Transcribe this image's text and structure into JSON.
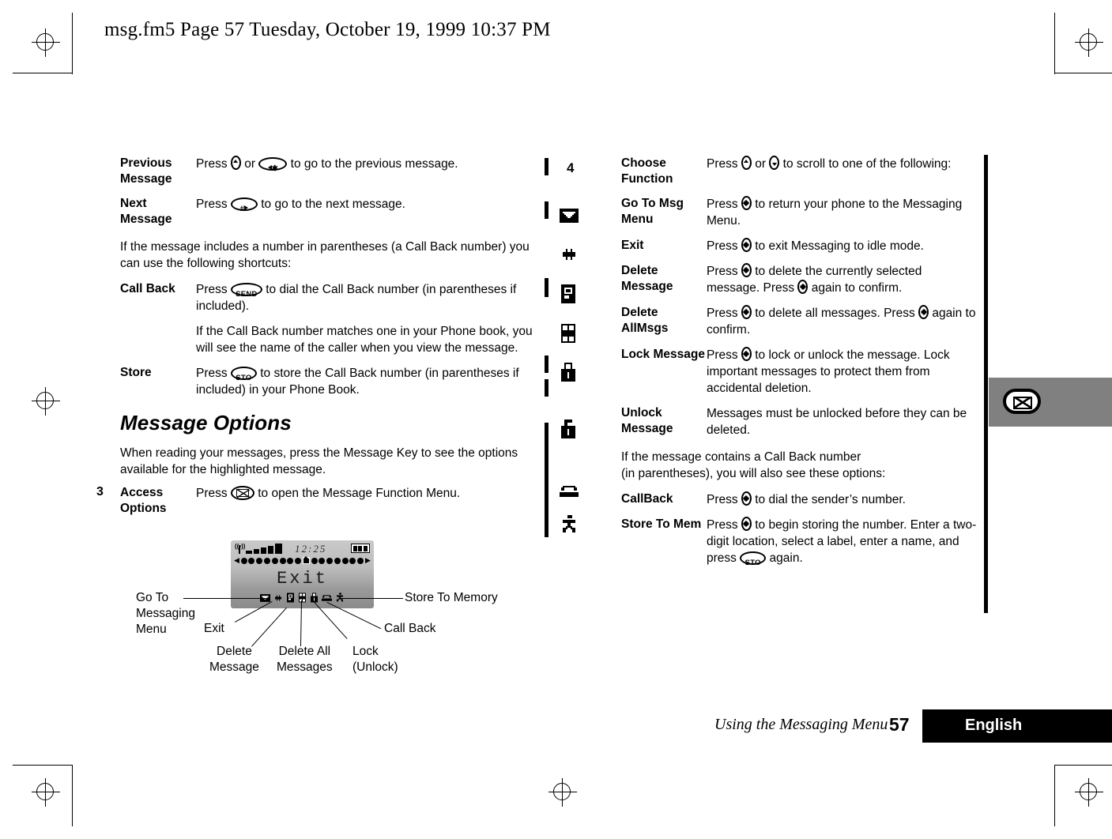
{
  "header": {
    "text": "msg.fm5  Page 57  Tuesday, October 19, 1999  10:37 PM"
  },
  "margin": {
    "change_marker_number": "4"
  },
  "left_column": {
    "rows": [
      {
        "term": "Previous Message",
        "lines": [
          "Press [nav-up] or [star-key] to go to the previous message."
        ]
      },
      {
        "term": "Next Message",
        "lines": [
          "Press [hash-key] to go to the next message."
        ]
      }
    ],
    "intro_paragraph": "If the message includes a number in parentheses (a Call Back number) you can use the following shortcuts:",
    "rows2": [
      {
        "term": "Call Back",
        "lines": [
          "Press [send-key] to dial the Call Back number (in parentheses if included).",
          "If the Call Back number matches one in your Phone book, you will see the name of the caller when you view the message."
        ]
      },
      {
        "term": "Store",
        "lines": [
          "Press [sto-key] to store the Call Back number (in parentheses if included) in your Phone Book."
        ]
      }
    ],
    "section_heading": "Message Options",
    "section_paragraph": "When reading your messages, press the Message Key to see the options available for the highlighted message.",
    "step": {
      "number": "3",
      "term": "Access Options",
      "text": "Press [msg-key] to open the Message Function Menu."
    }
  },
  "right_column": {
    "rows": [
      {
        "term": "Choose Function",
        "lines": [
          "Press [nav-up] or [nav-down] to scroll to one of the following:"
        ]
      },
      {
        "term": "Go To Msg Menu",
        "lines": [
          "Press [nav-sel] to return your phone to the Messaging Menu."
        ]
      },
      {
        "term": "Exit",
        "lines": [
          "Press [nav-sel] to exit Messaging to idle mode."
        ]
      },
      {
        "term": "Delete Message",
        "lines": [
          "Press [nav-sel] to delete the currently selected message. Press [nav-sel] again to confirm."
        ]
      },
      {
        "term": "Delete AllMsgs",
        "lines": [
          "Press [nav-sel] to delete all messages. Press [nav-sel] again to confirm."
        ]
      },
      {
        "term": "Lock Message",
        "lines": [
          "Press [nav-sel] to lock or unlock the message. Lock important messages to protect them from accidental deletion."
        ]
      },
      {
        "term": "Unlock Message",
        "lines": [
          "Messages must be unlocked before they can be deleted."
        ]
      }
    ],
    "note_paragraph": "If the message contains a Call Back number\n(in parentheses), you will also see these options:",
    "rows2": [
      {
        "term": "CallBack",
        "lines": [
          "Press [nav-sel] to dial the sender’s number."
        ]
      },
      {
        "term": "Store To Mem",
        "lines": [
          "Press [nav-sel] to begin storing the number. Enter a two-digit location, select a label, enter a name, and press [sto-key] again."
        ]
      }
    ]
  },
  "phone_display": {
    "signal_bars": 5,
    "time": "12:25",
    "battery_segments": 3,
    "screen_text": "Exit",
    "dot_count_left": 8,
    "dot_count_right": 8,
    "function_icons": [
      "envelope-icon",
      "exit-arrows-icon",
      "delete-message-icon",
      "delete-all-messages-icon",
      "lock-icon",
      "phone-handset-icon",
      "running-person-icon"
    ],
    "callouts": {
      "go_to_messaging_menu": "Go To\nMessaging\nMenu",
      "exit": "Exit",
      "delete_message": "Delete\nMessage",
      "delete_all_messages": "Delete All\nMessages",
      "lock_unlock": "Lock\n(Unlock)",
      "call_back": "Call Back",
      "store_to_memory": "Store To Memory"
    }
  },
  "icon_legend": [
    "envelope-icon",
    "exit-arrows-icon",
    "delete-message-icon",
    "delete-all-messages-icon",
    "lock-closed-icon",
    "lock-open-icon",
    "phone-handset-icon",
    "running-person-icon"
  ],
  "edge_tab": {
    "icon": "message-envelope-key-icon",
    "color": "#808080"
  },
  "footer": {
    "title": "Using the Messaging Menu",
    "page_number": "57",
    "language": "English"
  }
}
